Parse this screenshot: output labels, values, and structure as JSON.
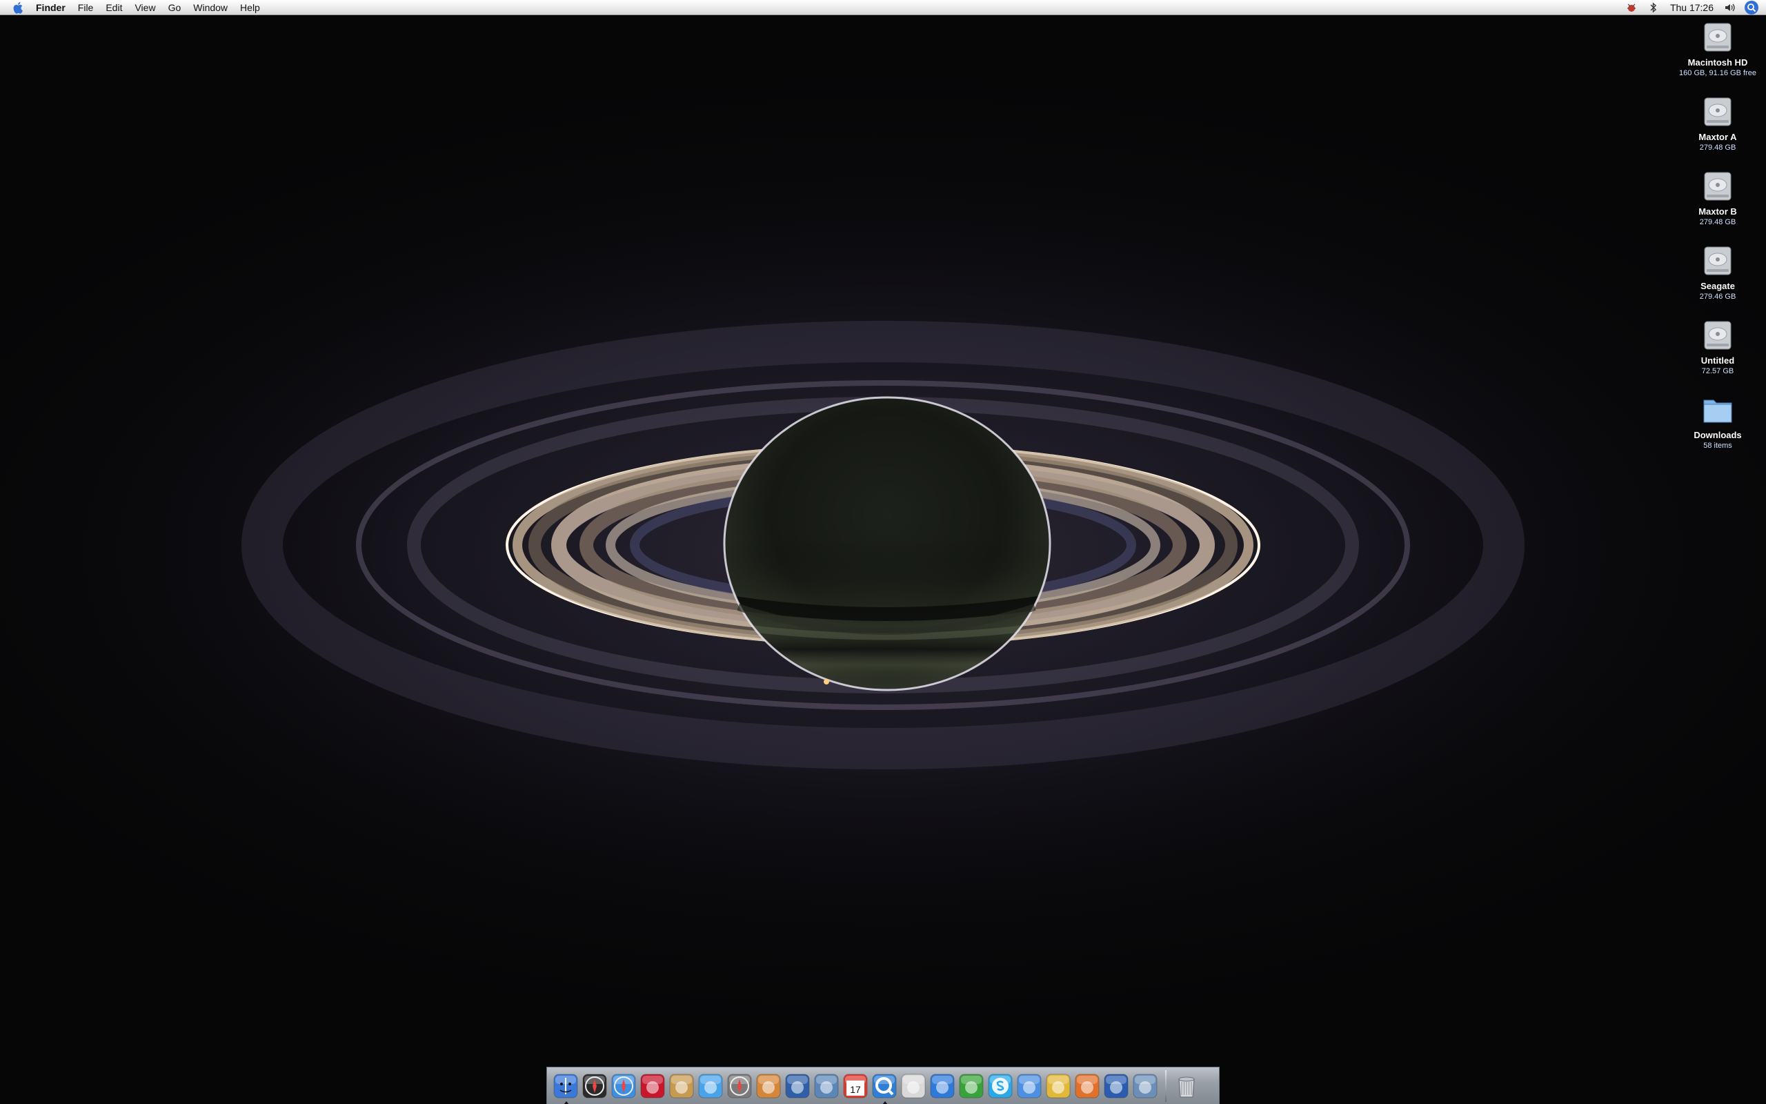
{
  "menubar": {
    "app_name": "Finder",
    "menus": [
      "File",
      "Edit",
      "View",
      "Go",
      "Window",
      "Help"
    ],
    "clock": "Thu 17:26",
    "status_icons": [
      "bug-status-icon",
      "bluetooth-icon",
      "volume-icon",
      "spotlight-icon"
    ]
  },
  "desktop": {
    "icons": [
      {
        "name": "Macintosh HD",
        "info": "160 GB, 91.16 GB free",
        "icon": "hard-drive-icon"
      },
      {
        "name": "Maxtor A",
        "info": "279.48 GB",
        "icon": "hard-drive-icon"
      },
      {
        "name": "Maxtor B",
        "info": "279.48 GB",
        "icon": "hard-drive-icon"
      },
      {
        "name": "Seagate",
        "info": "279.46 GB",
        "icon": "hard-drive-icon"
      },
      {
        "name": "Untitled",
        "info": "72.57 GB",
        "icon": "hard-drive-icon"
      },
      {
        "name": "Downloads",
        "info": "58 items",
        "icon": "folder-icon"
      }
    ]
  },
  "dock": {
    "calendar_day": "17",
    "apps": [
      {
        "icon": "finder-icon",
        "color": "#3b78d8",
        "running": true
      },
      {
        "icon": "dashboard-icon",
        "color": "#2a2a2a",
        "running": false
      },
      {
        "icon": "safari-icon",
        "color": "#3d8fe0",
        "running": false
      },
      {
        "icon": "yahoo-widget-icon",
        "color": "#c8162c",
        "running": false
      },
      {
        "icon": "address-book-icon",
        "color": "#c79a52",
        "running": false
      },
      {
        "icon": "itunes-icon",
        "color": "#4aa3e8",
        "running": false
      },
      {
        "icon": "dvd-player-icon",
        "color": "#7a7a7a",
        "running": false
      },
      {
        "icon": "iphoto-icon",
        "color": "#d4873a",
        "running": false
      },
      {
        "icon": "imovie-icon",
        "color": "#2f5fa8",
        "running": false
      },
      {
        "icon": "preview-icon",
        "color": "#5b86b8",
        "running": false
      },
      {
        "icon": "ical-icon",
        "color": "#e03a2f",
        "running": false
      },
      {
        "icon": "quicktime-icon",
        "color": "#2f7fd4",
        "running": true
      },
      {
        "icon": "crossover-icon",
        "color": "#d9d9d9",
        "running": false
      },
      {
        "icon": "word-icon",
        "color": "#2f79d9",
        "running": false
      },
      {
        "icon": "excel-icon",
        "color": "#3aa23a",
        "running": false
      },
      {
        "icon": "skype-icon",
        "color": "#2aa8e8",
        "running": false
      },
      {
        "icon": "ichat-icon",
        "color": "#4d8fe0",
        "running": false
      },
      {
        "icon": "adium-icon",
        "color": "#e2b83a",
        "running": false
      },
      {
        "icon": "matlab-icon",
        "color": "#e0702a",
        "running": false
      },
      {
        "icon": "thunderbird-icon",
        "color": "#2a5db0",
        "running": false
      },
      {
        "icon": "image-capture-icon",
        "color": "#6b8fb8",
        "running": false
      }
    ],
    "trash": {
      "icon": "trash-icon"
    }
  }
}
